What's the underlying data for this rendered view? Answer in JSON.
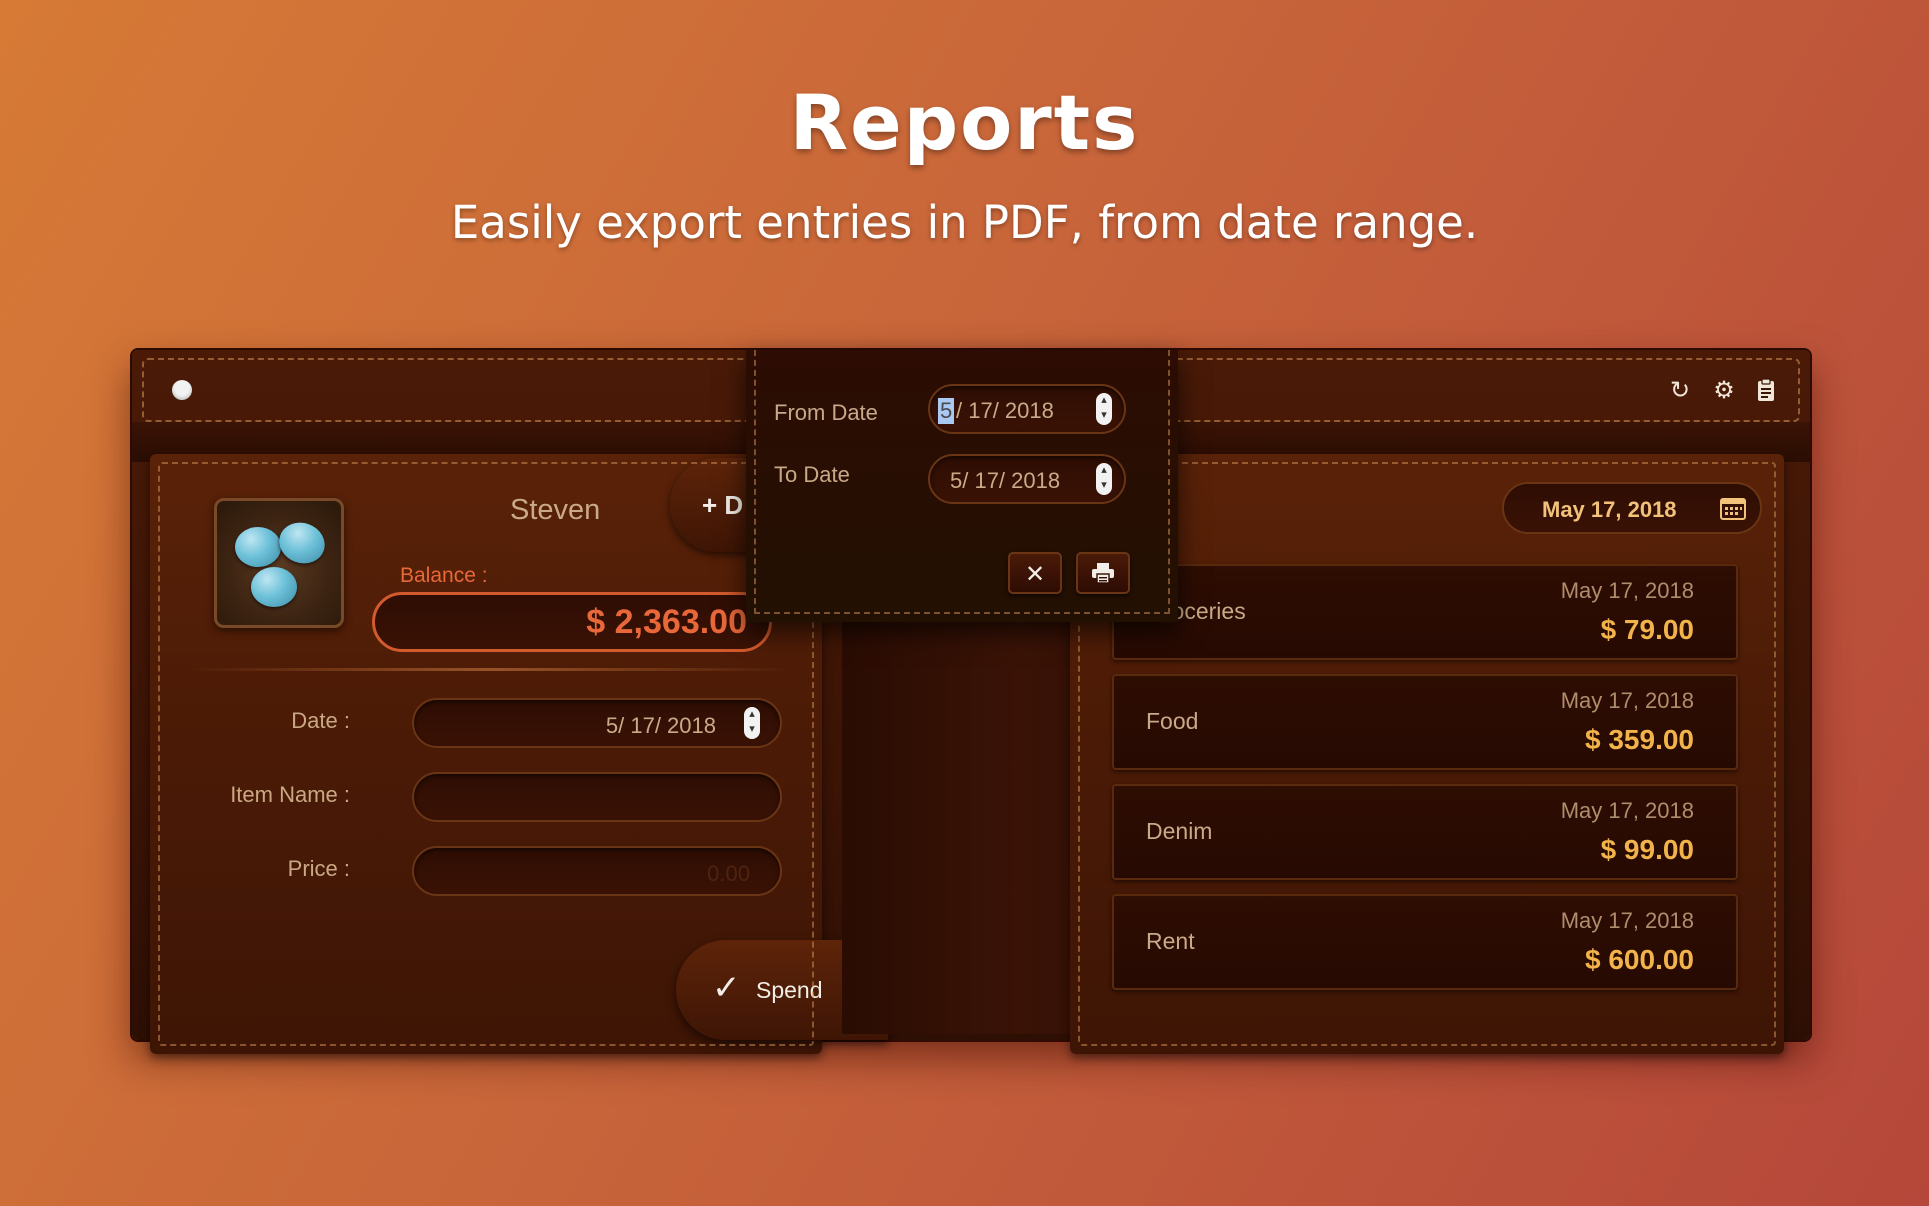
{
  "hero": {
    "title": "Reports",
    "subtitle": "Easily export entries in PDF, from date range."
  },
  "toolbar": {
    "refresh_icon": "↻",
    "settings_icon": "⚙",
    "clipboard_icon": "📋"
  },
  "left_panel": {
    "user_name": "Steven",
    "add_button_label": "+ D",
    "balance_label": "Balance :",
    "balance_value": "$ 2,363.00",
    "date_label": "Date :",
    "date_value": "5/ 17/ 2018",
    "item_name_label": "Item Name :",
    "item_name_value": "",
    "price_label": "Price :",
    "price_placeholder": "0.00",
    "spend_label": "Spend"
  },
  "report_popover": {
    "from_label": "From Date",
    "from_value_month": "5",
    "from_value_rest": "/ 17/ 2018",
    "to_label": "To Date",
    "to_value": "5/ 17/ 2018",
    "cancel_icon": "✕",
    "print_icon": "🖶"
  },
  "right_panel": {
    "selected_date": "May 17, 2018",
    "entries": [
      {
        "name": "Groceries",
        "date": "May 17, 2018",
        "amount": "$ 79.00"
      },
      {
        "name": "Food",
        "date": "May 17, 2018",
        "amount": "$ 359.00"
      },
      {
        "name": "Denim",
        "date": "May 17, 2018",
        "amount": "$ 99.00"
      },
      {
        "name": "Rent",
        "date": "May 17, 2018",
        "amount": "$ 600.00"
      }
    ]
  },
  "colors": {
    "accent_orange": "#f2b34a",
    "balance_orange": "#e8683a",
    "leather_dark": "#2e0d03"
  }
}
